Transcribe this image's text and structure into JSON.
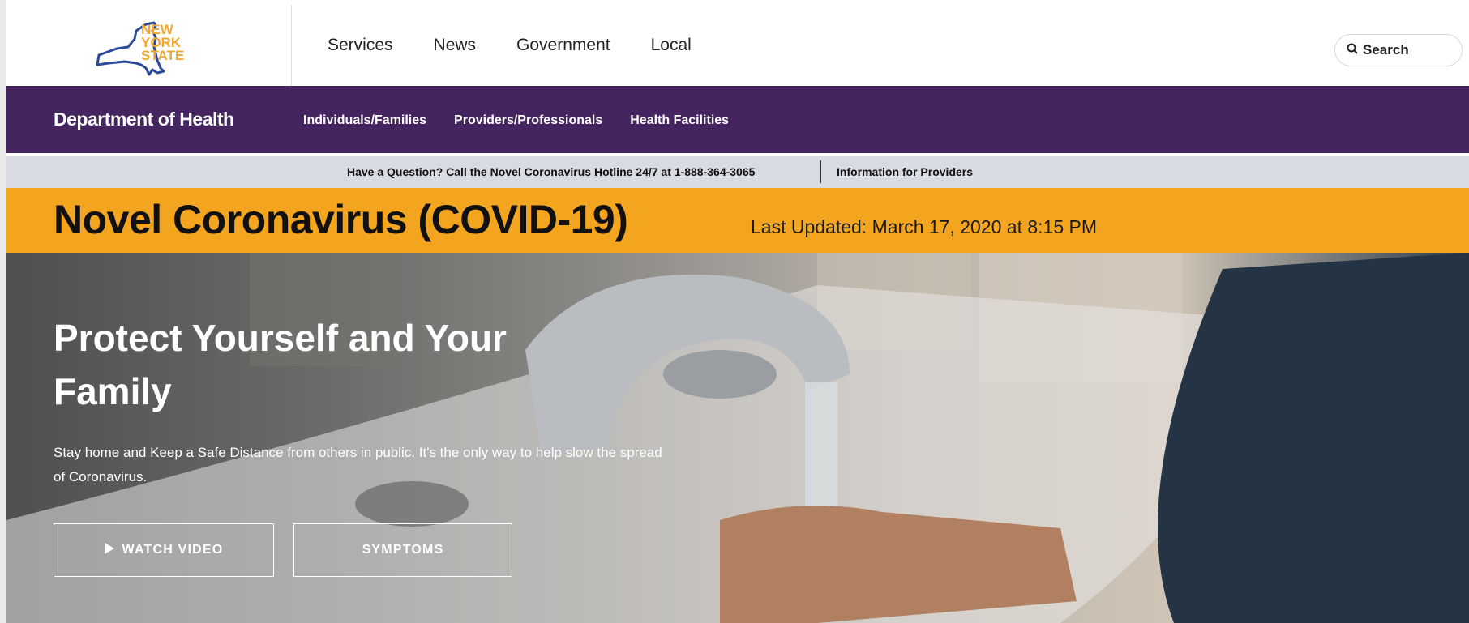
{
  "header": {
    "logo_text": [
      "NEW",
      "YORK",
      "STATE"
    ],
    "nav": [
      "Services",
      "News",
      "Government",
      "Local"
    ],
    "search_label": "Search"
  },
  "agency": {
    "name": "Department of Health",
    "nav": [
      "Individuals/Families",
      "Providers/Professionals",
      "Health Facilities"
    ]
  },
  "hotline": {
    "text": "Have a Question? Call the Novel Coronavirus Hotline 24/7 at ",
    "phone": "1-888-364-3065",
    "providers_link": "Information for Providers"
  },
  "alert": {
    "title": "Novel Coronavirus (COVID-19)",
    "updated": "Last Updated: March 17, 2020 at 8:15 PM"
  },
  "hero": {
    "title": "Protect Yourself and Your Family",
    "text": "Stay home and Keep a Safe Distance from others in public. It's the only way to help slow the spread of Coronavirus.",
    "buttons": {
      "watch_video": "WATCH VIDEO",
      "symptoms": "SYMPTOMS"
    }
  },
  "colors": {
    "accent_top": "#f0a830",
    "agency_purple": "#44255f",
    "hotline_bg": "#d9dbe2",
    "alert_orange": "#f3a51f",
    "logo_gold": "#f0a830",
    "logo_blue": "#2b4a9a"
  },
  "icons": {
    "search": "search-icon",
    "play": "play-icon",
    "logo": "ny-state-logo"
  }
}
